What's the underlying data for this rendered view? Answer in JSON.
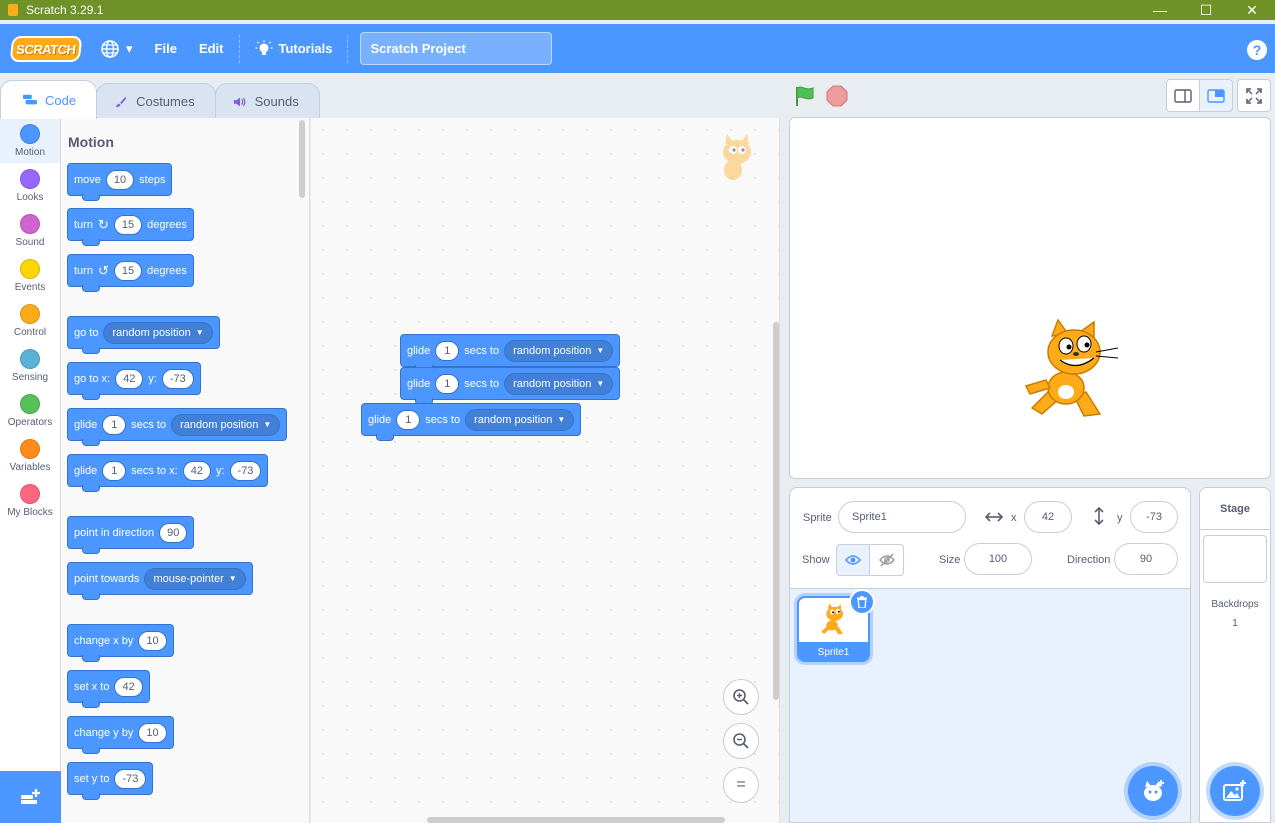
{
  "window": {
    "title": "Scratch 3.29.1",
    "minimize": "—",
    "maximize": "☐",
    "close": "✕"
  },
  "menubar": {
    "logo": "SCRATCH",
    "language_caret": "▾",
    "file": "File",
    "edit": "Edit",
    "tutorials": "Tutorials",
    "project_title": "Scratch Project",
    "help": "?"
  },
  "tabs": {
    "code": "Code",
    "costumes": "Costumes",
    "sounds": "Sounds"
  },
  "categories": [
    {
      "label": "Motion",
      "color": "#4c97ff"
    },
    {
      "label": "Looks",
      "color": "#9966ff"
    },
    {
      "label": "Sound",
      "color": "#cf63cf"
    },
    {
      "label": "Events",
      "color": "#ffd500"
    },
    {
      "label": "Control",
      "color": "#ffab19"
    },
    {
      "label": "Sensing",
      "color": "#5cb1d6"
    },
    {
      "label": "Operators",
      "color": "#59c059"
    },
    {
      "label": "Variables",
      "color": "#ff8c1a"
    },
    {
      "label": "My Blocks",
      "color": "#ff6680"
    }
  ],
  "flyout": {
    "title": "Motion",
    "move": {
      "a": "move",
      "n": "10",
      "b": "steps"
    },
    "turn_right": {
      "a": "turn",
      "n": "15",
      "b": "degrees"
    },
    "turn_left": {
      "a": "turn",
      "n": "15",
      "b": "degrees"
    },
    "goto": {
      "a": "go to",
      "d": "random position"
    },
    "gotoxy": {
      "a": "go to x:",
      "x": "42",
      "b": "y:",
      "y": "-73"
    },
    "glide_to": {
      "a": "glide",
      "n": "1",
      "b": "secs to",
      "d": "random position"
    },
    "glide_xy": {
      "a": "glide",
      "n": "1",
      "b": "secs to x:",
      "x": "42",
      "c": "y:",
      "y": "-73"
    },
    "point_dir": {
      "a": "point in direction",
      "n": "90"
    },
    "point_towards": {
      "a": "point towards",
      "d": "mouse-pointer"
    },
    "change_x": {
      "a": "change x by",
      "n": "10"
    },
    "set_x": {
      "a": "set x to",
      "n": "42"
    },
    "change_y": {
      "a": "change y by",
      "n": "10"
    },
    "set_y": {
      "a": "set y to",
      "n": "-73"
    }
  },
  "script": [
    {
      "a": "glide",
      "n": "1",
      "b": "secs to",
      "d": "random position"
    },
    {
      "a": "glide",
      "n": "1",
      "b": "secs to",
      "d": "random position"
    },
    {
      "a": "glide",
      "n": "1",
      "b": "secs to",
      "d": "random position"
    }
  ],
  "zoom": {
    "in": "+",
    "out": "−",
    "reset": "="
  },
  "sprite_info": {
    "sprite_label": "Sprite",
    "sprite_name": "Sprite1",
    "x_label": "x",
    "x_value": "42",
    "y_label": "y",
    "y_value": "-73",
    "show_label": "Show",
    "size_label": "Size",
    "size_value": "100",
    "direction_label": "Direction",
    "direction_value": "90"
  },
  "sprites": [
    {
      "name": "Sprite1"
    }
  ],
  "stage_pane": {
    "title": "Stage",
    "backdrops_label": "Backdrops",
    "backdrops_count": "1"
  },
  "colors": {
    "accent": "#4c97ff",
    "titlebar": "#6e9228",
    "flag": "#4cbf56",
    "stop": "#ec5959"
  }
}
